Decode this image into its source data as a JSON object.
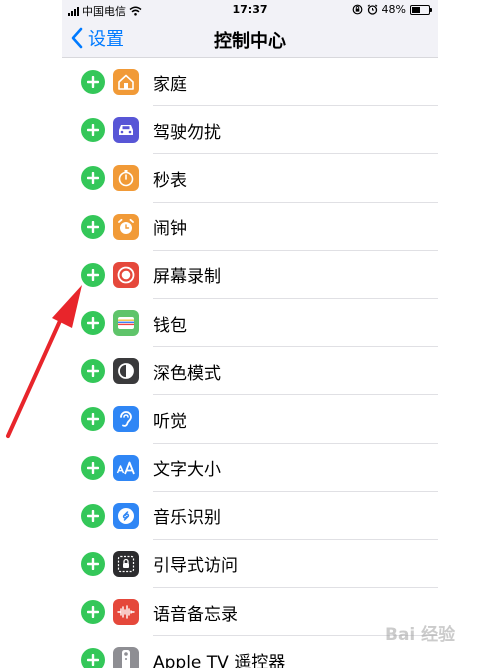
{
  "status_bar": {
    "carrier": "中国电信",
    "time": "17:37",
    "battery_percent": "48%",
    "battery_level": 0.48
  },
  "nav": {
    "back_label": "设置",
    "title": "控制中心"
  },
  "items": [
    {
      "label": "家庭",
      "icon": "home-icon",
      "color": "#f19a37"
    },
    {
      "label": "驾驶勿扰",
      "icon": "car-icon",
      "color": "#5856d6"
    },
    {
      "label": "秒表",
      "icon": "stopwatch-icon",
      "color": "#f19a37"
    },
    {
      "label": "闹钟",
      "icon": "alarm-clock-icon",
      "color": "#f19a37"
    },
    {
      "label": "屏幕录制",
      "icon": "screen-record-icon",
      "color": "#e5483b"
    },
    {
      "label": "钱包",
      "icon": "wallet-icon",
      "color": "#5fc46a"
    },
    {
      "label": "深色模式",
      "icon": "dark-mode-icon",
      "color": "#3a3a3c"
    },
    {
      "label": "听觉",
      "icon": "ear-icon",
      "color": "#2f86f5"
    },
    {
      "label": "文字大小",
      "icon": "text-size-icon",
      "color": "#2f86f5"
    },
    {
      "label": "音乐识别",
      "icon": "shazam-icon",
      "color": "#2f86f5"
    },
    {
      "label": "引导式访问",
      "icon": "guided-access-icon",
      "color": "#2c2c2e"
    },
    {
      "label": "语音备忘录",
      "icon": "voice-memo-icon",
      "color": "#e5483b"
    },
    {
      "label": "Apple TV 遥控器",
      "icon": "tv-remote-icon",
      "color": "#8e8e93"
    }
  ],
  "watermark": "Bai 经验",
  "accent_colors": {
    "link": "#007aff",
    "add": "#34c759",
    "arrow": "#e8252b"
  }
}
